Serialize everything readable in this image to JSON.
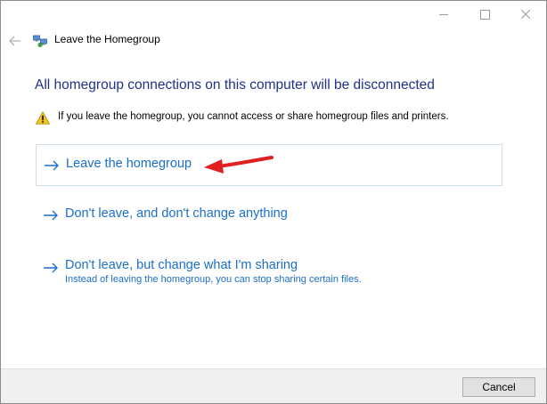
{
  "window": {
    "title": "Leave the Homegroup"
  },
  "content": {
    "heading": "All homegroup connections on this computer will be disconnected",
    "warning": "If you leave the homegroup, you cannot access or share homegroup files and printers.",
    "options": [
      {
        "label": "Leave the homegroup",
        "description": "",
        "selected": true
      },
      {
        "label": "Don't leave, and don't change anything",
        "description": ""
      },
      {
        "label": "Don't leave, but change what I'm sharing",
        "description": "Instead of leaving the homegroup, you can stop sharing certain files."
      }
    ]
  },
  "footer": {
    "cancel_label": "Cancel"
  },
  "colors": {
    "heading": "#1e3287",
    "link": "#1a6fc9",
    "annotation_arrow": "#e02020",
    "selection_border": "#cde0ec"
  },
  "icons": {
    "app": "homegroup-icon",
    "warning": "warning-icon",
    "back": "back-arrow-icon",
    "option_arrow": "right-arrow-icon"
  }
}
